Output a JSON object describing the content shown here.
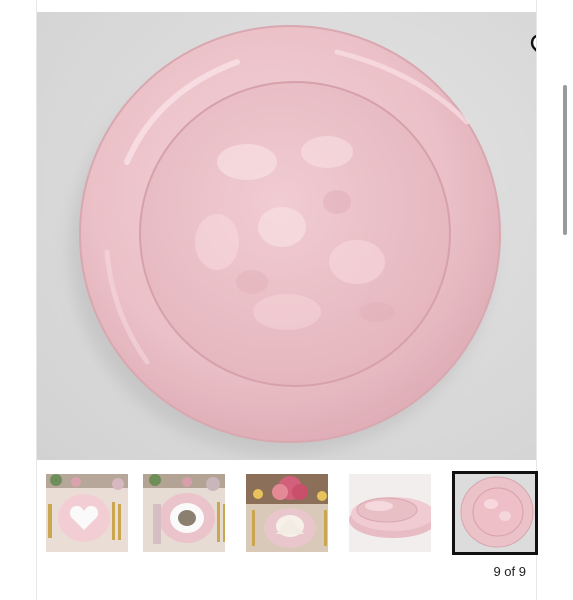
{
  "product_image": {
    "icon": "pink-dinner-plate-photo",
    "plate_color": "#eec5cb",
    "favorite_icon": "heart-outline-icon"
  },
  "thumbnails": [
    {
      "icon": "table-setting-heart-plate-thumbnail",
      "selected": false
    },
    {
      "icon": "table-setting-gold-cutlery-thumbnail",
      "selected": false
    },
    {
      "icon": "table-setting-flowers-thumbnail",
      "selected": false
    },
    {
      "icon": "stacked-plates-thumbnail",
      "selected": false
    },
    {
      "icon": "pink-plate-thumbnail",
      "selected": true
    }
  ],
  "pagination": {
    "counter": "9 of 9"
  }
}
